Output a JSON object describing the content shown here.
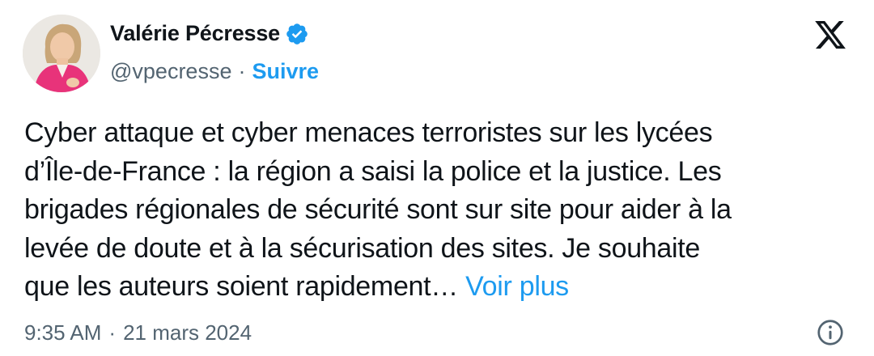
{
  "author": {
    "name": "Valérie Pécresse",
    "handle": "@vpecresse",
    "separator": "·",
    "follow_label": "Suivre",
    "avatar_icon": "avatar-photo",
    "verified_icon": "verified-badge-icon"
  },
  "platform": {
    "logo_icon": "x-logo-icon"
  },
  "tweet": {
    "lines": [
      "Cyber attaque et cyber menaces terroristes sur les lycées",
      "d’Île-de-France : la région a saisi la police et la justice. Les",
      "brigades régionales de sécurité sont sur site pour aider à la",
      "levée de doute et à la sécurisation des sites. Je souhaite",
      "que les auteurs soient rapidement…"
    ],
    "read_more_label": "Voir plus"
  },
  "meta": {
    "time": "9:35 AM",
    "separator": "·",
    "date": "21 mars 2024",
    "info_icon": "info-icon"
  },
  "colors": {
    "accent": "#1d9bf0",
    "secondary_text": "#536471",
    "primary_text": "#0f1419",
    "avatar_jacket": "#e8337a"
  }
}
